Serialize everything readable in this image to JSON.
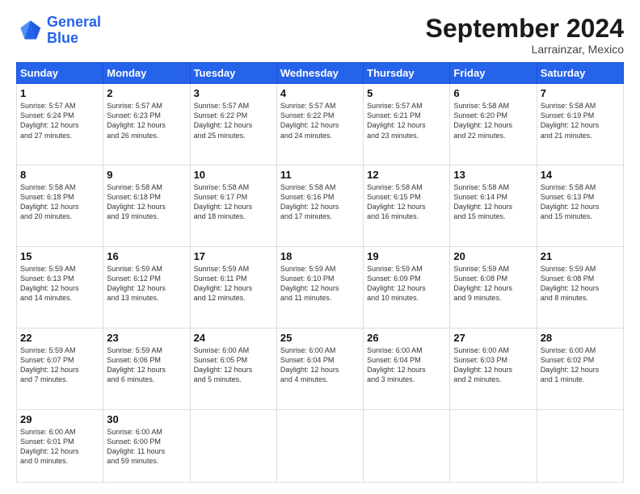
{
  "logo": {
    "line1": "General",
    "line2": "Blue"
  },
  "header": {
    "month": "September 2024",
    "location": "Larrainzar, Mexico"
  },
  "weekdays": [
    "Sunday",
    "Monday",
    "Tuesday",
    "Wednesday",
    "Thursday",
    "Friday",
    "Saturday"
  ],
  "weeks": [
    [
      {
        "day": "1",
        "info": "Sunrise: 5:57 AM\nSunset: 6:24 PM\nDaylight: 12 hours\nand 27 minutes."
      },
      {
        "day": "2",
        "info": "Sunrise: 5:57 AM\nSunset: 6:23 PM\nDaylight: 12 hours\nand 26 minutes."
      },
      {
        "day": "3",
        "info": "Sunrise: 5:57 AM\nSunset: 6:22 PM\nDaylight: 12 hours\nand 25 minutes."
      },
      {
        "day": "4",
        "info": "Sunrise: 5:57 AM\nSunset: 6:22 PM\nDaylight: 12 hours\nand 24 minutes."
      },
      {
        "day": "5",
        "info": "Sunrise: 5:57 AM\nSunset: 6:21 PM\nDaylight: 12 hours\nand 23 minutes."
      },
      {
        "day": "6",
        "info": "Sunrise: 5:58 AM\nSunset: 6:20 PM\nDaylight: 12 hours\nand 22 minutes."
      },
      {
        "day": "7",
        "info": "Sunrise: 5:58 AM\nSunset: 6:19 PM\nDaylight: 12 hours\nand 21 minutes."
      }
    ],
    [
      {
        "day": "8",
        "info": "Sunrise: 5:58 AM\nSunset: 6:18 PM\nDaylight: 12 hours\nand 20 minutes."
      },
      {
        "day": "9",
        "info": "Sunrise: 5:58 AM\nSunset: 6:18 PM\nDaylight: 12 hours\nand 19 minutes."
      },
      {
        "day": "10",
        "info": "Sunrise: 5:58 AM\nSunset: 6:17 PM\nDaylight: 12 hours\nand 18 minutes."
      },
      {
        "day": "11",
        "info": "Sunrise: 5:58 AM\nSunset: 6:16 PM\nDaylight: 12 hours\nand 17 minutes."
      },
      {
        "day": "12",
        "info": "Sunrise: 5:58 AM\nSunset: 6:15 PM\nDaylight: 12 hours\nand 16 minutes."
      },
      {
        "day": "13",
        "info": "Sunrise: 5:58 AM\nSunset: 6:14 PM\nDaylight: 12 hours\nand 15 minutes."
      },
      {
        "day": "14",
        "info": "Sunrise: 5:58 AM\nSunset: 6:13 PM\nDaylight: 12 hours\nand 15 minutes."
      }
    ],
    [
      {
        "day": "15",
        "info": "Sunrise: 5:59 AM\nSunset: 6:13 PM\nDaylight: 12 hours\nand 14 minutes."
      },
      {
        "day": "16",
        "info": "Sunrise: 5:59 AM\nSunset: 6:12 PM\nDaylight: 12 hours\nand 13 minutes."
      },
      {
        "day": "17",
        "info": "Sunrise: 5:59 AM\nSunset: 6:11 PM\nDaylight: 12 hours\nand 12 minutes."
      },
      {
        "day": "18",
        "info": "Sunrise: 5:59 AM\nSunset: 6:10 PM\nDaylight: 12 hours\nand 11 minutes."
      },
      {
        "day": "19",
        "info": "Sunrise: 5:59 AM\nSunset: 6:09 PM\nDaylight: 12 hours\nand 10 minutes."
      },
      {
        "day": "20",
        "info": "Sunrise: 5:59 AM\nSunset: 6:08 PM\nDaylight: 12 hours\nand 9 minutes."
      },
      {
        "day": "21",
        "info": "Sunrise: 5:59 AM\nSunset: 6:08 PM\nDaylight: 12 hours\nand 8 minutes."
      }
    ],
    [
      {
        "day": "22",
        "info": "Sunrise: 5:59 AM\nSunset: 6:07 PM\nDaylight: 12 hours\nand 7 minutes."
      },
      {
        "day": "23",
        "info": "Sunrise: 5:59 AM\nSunset: 6:06 PM\nDaylight: 12 hours\nand 6 minutes."
      },
      {
        "day": "24",
        "info": "Sunrise: 6:00 AM\nSunset: 6:05 PM\nDaylight: 12 hours\nand 5 minutes."
      },
      {
        "day": "25",
        "info": "Sunrise: 6:00 AM\nSunset: 6:04 PM\nDaylight: 12 hours\nand 4 minutes."
      },
      {
        "day": "26",
        "info": "Sunrise: 6:00 AM\nSunset: 6:04 PM\nDaylight: 12 hours\nand 3 minutes."
      },
      {
        "day": "27",
        "info": "Sunrise: 6:00 AM\nSunset: 6:03 PM\nDaylight: 12 hours\nand 2 minutes."
      },
      {
        "day": "28",
        "info": "Sunrise: 6:00 AM\nSunset: 6:02 PM\nDaylight: 12 hours\nand 1 minute."
      }
    ],
    [
      {
        "day": "29",
        "info": "Sunrise: 6:00 AM\nSunset: 6:01 PM\nDaylight: 12 hours\nand 0 minutes."
      },
      {
        "day": "30",
        "info": "Sunrise: 6:00 AM\nSunset: 6:00 PM\nDaylight: 11 hours\nand 59 minutes."
      },
      {
        "day": "",
        "info": ""
      },
      {
        "day": "",
        "info": ""
      },
      {
        "day": "",
        "info": ""
      },
      {
        "day": "",
        "info": ""
      },
      {
        "day": "",
        "info": ""
      }
    ]
  ]
}
